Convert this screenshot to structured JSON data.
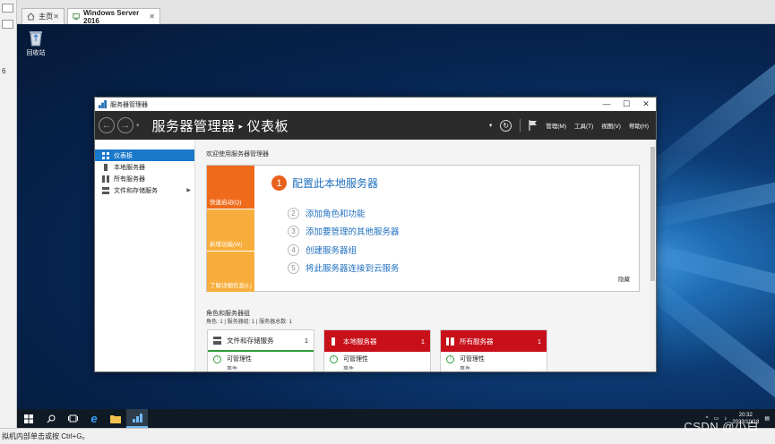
{
  "vm_tabs": [
    {
      "label": "主页",
      "icon": "home-icon"
    },
    {
      "label": "Windows Server 2016",
      "icon": "vm-icon"
    }
  ],
  "left_strip": {
    "digit": "6"
  },
  "desktop": {
    "recycle_bin_label": "回收站"
  },
  "window": {
    "title": "服务器管理器",
    "breadcrumb_app": "服务器管理器",
    "breadcrumb_sep": "▸",
    "breadcrumb_page": "仪表板",
    "menus": [
      "管理(M)",
      "工具(T)",
      "视图(V)",
      "帮助(H)"
    ],
    "controls": {
      "minimize": "—",
      "maximize": "☐",
      "close": "✕"
    }
  },
  "sidebar": {
    "items": [
      {
        "label": "仪表板",
        "selected": true
      },
      {
        "label": "本地服务器"
      },
      {
        "label": "所有服务器"
      },
      {
        "label": "文件和存储服务",
        "has_arrow": true
      }
    ]
  },
  "welcome": {
    "heading": "欢迎使用服务器管理器",
    "left_tabs": [
      "快速启动(Q)",
      "新增功能(W)",
      "了解详细信息(L)"
    ],
    "step1": {
      "num": "1",
      "label": "配置此本地服务器"
    },
    "steps": [
      {
        "num": "2",
        "label": "添加角色和功能"
      },
      {
        "num": "3",
        "label": "添加要管理的其他服务器"
      },
      {
        "num": "4",
        "label": "创建服务器组"
      },
      {
        "num": "5",
        "label": "将此服务器连接到云服务"
      }
    ],
    "hide": "隐藏"
  },
  "roles": {
    "title": "角色和服务器组",
    "summary": "角色: 1 | 服务器组: 1 | 服务器总数: 1",
    "tiles": [
      {
        "name": "文件和存储服务",
        "count": "1",
        "row1": "可管理性",
        "row2": "事件",
        "color": "#ffffff",
        "accent": "#2e9c3a"
      },
      {
        "name": "本地服务器",
        "count": "1",
        "row1": "可管理性",
        "row2": "事件",
        "color": "#c8101a",
        "accent": "#c8101a"
      },
      {
        "name": "所有服务器",
        "count": "1",
        "row1": "可管理性",
        "row2": "事件",
        "color": "#c8101a",
        "accent": "#c8101a"
      }
    ]
  },
  "taskbar": {
    "clock_time": "20:32",
    "clock_date": "2023/10/18"
  },
  "statusbar": {
    "text": "拟机内部单击或按 Ctrl+G。"
  },
  "watermark": "CSDN @小白",
  "colors": {
    "cmdbar": "#2b2b2b",
    "quickstart_orange": "#ef6b1b",
    "tab_yellow": "#f7ae3c",
    "link_blue": "#1f6fbf",
    "selected_nav": "#1979ca",
    "alert_red": "#c8101a"
  }
}
